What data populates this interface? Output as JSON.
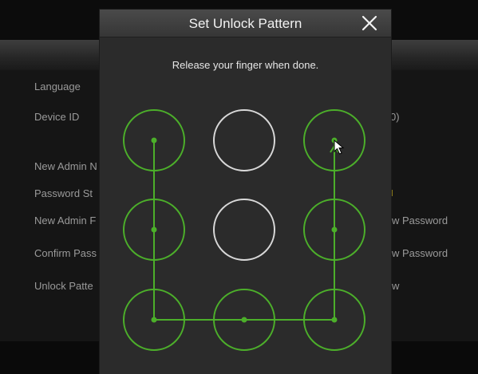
{
  "background_form": {
    "labels": [
      "Language",
      "Device ID",
      "New Admin N",
      "Password St",
      "New Admin F",
      "Confirm Pass",
      "Unlock Patte"
    ],
    "device_id_suffix": "0)",
    "show_password_1": "w Password",
    "show_password_2": "w Password",
    "draw_suffix": "w"
  },
  "dialog": {
    "title": "Set Unlock Pattern",
    "close_icon": "close-icon",
    "instruction": "Release your finger when done."
  },
  "pattern": {
    "grid_size": 3,
    "nodes": [
      {
        "row": 1,
        "col": 1,
        "selected": true
      },
      {
        "row": 1,
        "col": 2,
        "selected": false
      },
      {
        "row": 1,
        "col": 3,
        "selected": true
      },
      {
        "row": 2,
        "col": 1,
        "selected": true
      },
      {
        "row": 2,
        "col": 2,
        "selected": false
      },
      {
        "row": 2,
        "col": 3,
        "selected": true
      },
      {
        "row": 3,
        "col": 1,
        "selected": true
      },
      {
        "row": 3,
        "col": 2,
        "selected": true
      },
      {
        "row": 3,
        "col": 3,
        "selected": true
      }
    ],
    "path_order": [
      1,
      4,
      7,
      8,
      9,
      6,
      3
    ],
    "selected_color": "#4caf2a",
    "unselected_color": "#d8d8d8"
  },
  "colors": {
    "dialog_bg": "#2b2b2b",
    "title_text": "#f2f2f2"
  }
}
